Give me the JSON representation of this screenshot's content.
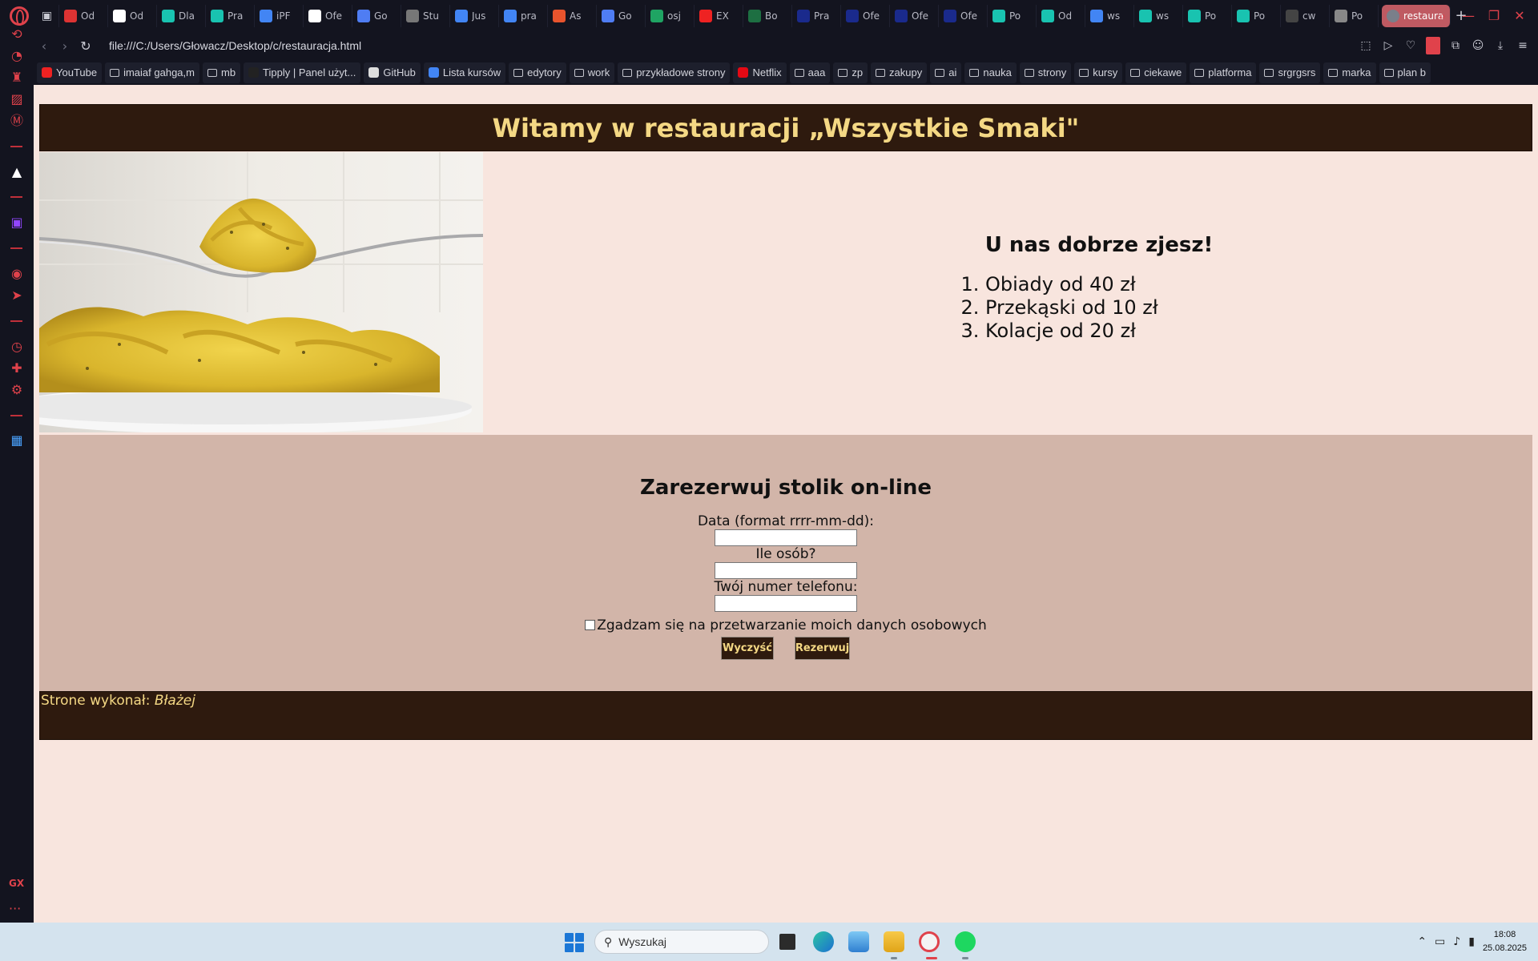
{
  "browser": {
    "tabs": [
      {
        "label": "Od",
        "fav": "#d33",
        "icon": "gmail-icon"
      },
      {
        "label": "Od",
        "fav": "#fff",
        "icon": "check-icon"
      },
      {
        "label": "Dla",
        "fav": "#19c3b0",
        "icon": "pp-icon"
      },
      {
        "label": "Pra",
        "fav": "#19c3b0",
        "icon": "pp-icon"
      },
      {
        "label": "iPF",
        "fav": "#4285f4",
        "icon": "google-icon"
      },
      {
        "label": "Ofe",
        "fav": "#fff",
        "icon": "info-icon"
      },
      {
        "label": "Go",
        "fav": "#4f7df3",
        "icon": "gemini-icon"
      },
      {
        "label": "Stu",
        "fav": "#777",
        "icon": "openai-icon"
      },
      {
        "label": "Jus",
        "fav": "#4285f4",
        "icon": "google-icon"
      },
      {
        "label": "pra",
        "fav": "#4285f4",
        "icon": "google-icon"
      },
      {
        "label": "As",
        "fav": "#e8542d",
        "icon": "brave-icon"
      },
      {
        "label": "Go",
        "fav": "#4f7df3",
        "icon": "gemini-icon"
      },
      {
        "label": "osj",
        "fav": "#1fa463",
        "icon": "drive-icon"
      },
      {
        "label": "EX",
        "fav": "#e22",
        "icon": "youtube-icon"
      },
      {
        "label": "Bo",
        "fav": "#1d6f42",
        "icon": "excel-icon"
      },
      {
        "label": "Pra",
        "fav": "#1a2a8c",
        "icon": "pracuj-icon"
      },
      {
        "label": "Ofe",
        "fav": "#1a2a8c",
        "icon": "pracuj-icon"
      },
      {
        "label": "Ofe",
        "fav": "#1a2a8c",
        "icon": "pracuj-icon"
      },
      {
        "label": "Ofe",
        "fav": "#1a2a8c",
        "icon": "pracuj-icon"
      },
      {
        "label": "Po",
        "fav": "#19c3b0",
        "icon": "pp-icon"
      },
      {
        "label": "Od",
        "fav": "#19c3b0",
        "icon": "pp-icon"
      },
      {
        "label": "ws",
        "fav": "#4285f4",
        "icon": "google-icon"
      },
      {
        "label": "ws",
        "fav": "#19c3b0",
        "icon": "pp-icon"
      },
      {
        "label": "Po",
        "fav": "#19c3b0",
        "icon": "pp-icon"
      },
      {
        "label": "Po",
        "fav": "#19c3b0",
        "icon": "pp-icon"
      },
      {
        "label": "cw",
        "fav": "#444",
        "icon": "github-icon"
      },
      {
        "label": "Po",
        "fav": "#888",
        "icon": "globe-icon"
      }
    ],
    "active_tab": "restaura",
    "url": "file:///C:/Users/Głowacz/Desktop/c/restauracja.html",
    "bookmarks": [
      {
        "label": "YouTube",
        "type": "icon",
        "color": "#e22"
      },
      {
        "label": "imaiaf gahga,m",
        "type": "folder"
      },
      {
        "label": "mb",
        "type": "folder"
      },
      {
        "label": "Tipply | Panel użyt...",
        "type": "icon",
        "color": "#222"
      },
      {
        "label": "GitHub",
        "type": "icon",
        "color": "#ddd"
      },
      {
        "label": "Lista kursów",
        "type": "icon",
        "color": "#4285f4"
      },
      {
        "label": "edytory",
        "type": "folder"
      },
      {
        "label": "work",
        "type": "folder"
      },
      {
        "label": "przykładowe strony",
        "type": "folder"
      },
      {
        "label": "Netflix",
        "type": "icon",
        "color": "#e50914"
      },
      {
        "label": "aaa",
        "type": "folder"
      },
      {
        "label": "zp",
        "type": "folder"
      },
      {
        "label": "zakupy",
        "type": "folder"
      },
      {
        "label": "ai",
        "type": "folder"
      },
      {
        "label": "nauka",
        "type": "folder"
      },
      {
        "label": "strony",
        "type": "folder"
      },
      {
        "label": "kursy",
        "type": "folder"
      },
      {
        "label": "ciekawe",
        "type": "folder"
      },
      {
        "label": "platforma",
        "type": "folder"
      },
      {
        "label": "srgrgsrs",
        "type": "folder"
      },
      {
        "label": "marka",
        "type": "folder"
      },
      {
        "label": "plan b",
        "type": "folder"
      }
    ],
    "sidebar_gx": "GX"
  },
  "page": {
    "banner_title": "Witamy w restauracji „Wszystkie Smaki\"",
    "promo_heading": "U nas dobrze zjesz!",
    "promo_items": [
      "Obiady od 40 zł",
      "Przekąski od 10 zł",
      "Kolacje od 20 zł"
    ],
    "form": {
      "heading": "Zarezerwuj stolik on-line",
      "date_label": "Data (format rrrr-mm-dd):",
      "date_value": "",
      "people_label": "Ile osób?",
      "people_value": "",
      "phone_label": "Twój numer telefonu:",
      "phone_value": "",
      "consent_label": "Zgadzam się na przetwarzanie moich danych osobowych",
      "consent_checked": false,
      "clear_button": "Wyczyść",
      "submit_button": "Rezerwuj"
    },
    "footer_prefix": "Strone wykonał:",
    "footer_author": "Błażej",
    "colors": {
      "banner_bg": "#2e1a0e",
      "banner_text": "#f4d884",
      "page_bg": "#f8e5de",
      "form_bg": "#d2b5a9"
    }
  },
  "taskbar": {
    "search_placeholder": "Wyszukaj",
    "time": "18:08",
    "date": "25.08.2025"
  }
}
